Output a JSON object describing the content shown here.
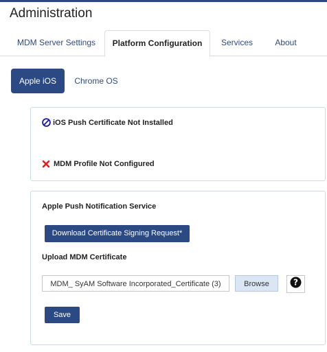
{
  "header": {
    "title": "Administration"
  },
  "tabs": [
    {
      "label": "MDM Server Settings",
      "active": false
    },
    {
      "label": "Platform Configuration",
      "active": true
    },
    {
      "label": "Services",
      "active": false
    },
    {
      "label": "About",
      "active": false
    }
  ],
  "platforms": [
    {
      "label": "Apple iOS",
      "active": true
    },
    {
      "label": "Chrome OS",
      "active": false
    }
  ],
  "status": {
    "push_cert": "iOS Push Certificate Not Installed",
    "mdm_profile": "MDM Profile Not Configured"
  },
  "apns": {
    "section_title": "Apple Push Notification Service",
    "download_button": "Download Certificate Signing Request*",
    "upload_label": "Upload MDM Certificate",
    "file_name": "MDM_ SyAM Software Incorporated_Certificate (3)",
    "browse_button": "Browse",
    "save_button": "Save"
  },
  "colors": {
    "primary": "#2b4a84",
    "error": "#e02020",
    "panel_border": "#c9dde8"
  },
  "icons": {
    "push_cert_status": "ban-icon",
    "mdm_profile_status": "x-icon",
    "help": "question-circle-icon"
  }
}
